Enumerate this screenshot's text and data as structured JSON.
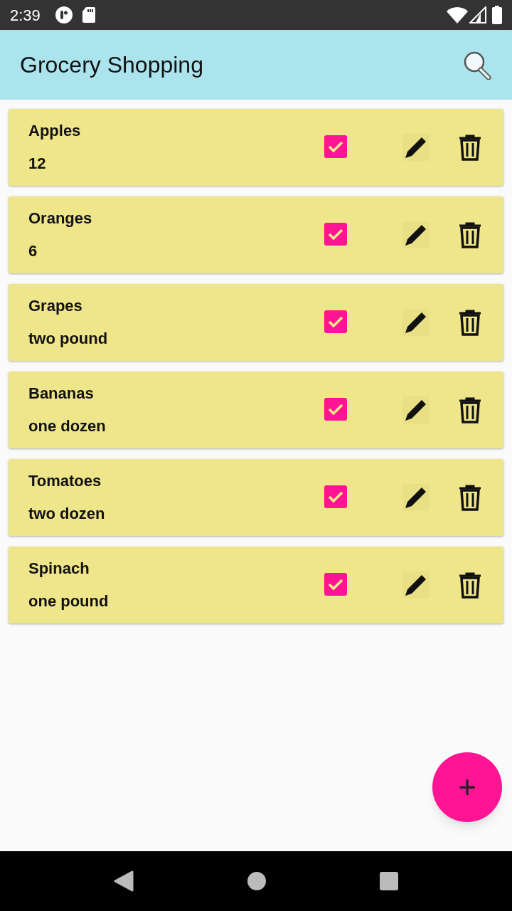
{
  "status_bar": {
    "time": "2:39"
  },
  "app_bar": {
    "title": "Grocery Shopping"
  },
  "items": [
    {
      "name": "Apples",
      "quantity": "12",
      "checked": true
    },
    {
      "name": "Oranges",
      "quantity": "6",
      "checked": true
    },
    {
      "name": "Grapes",
      "quantity": "two pound",
      "checked": true
    },
    {
      "name": "Bananas",
      "quantity": "one dozen",
      "checked": true
    },
    {
      "name": "Tomatoes",
      "quantity": "two dozen",
      "checked": true
    },
    {
      "name": "Spinach",
      "quantity": "one pound",
      "checked": true
    }
  ],
  "fab": {
    "label": "+"
  }
}
